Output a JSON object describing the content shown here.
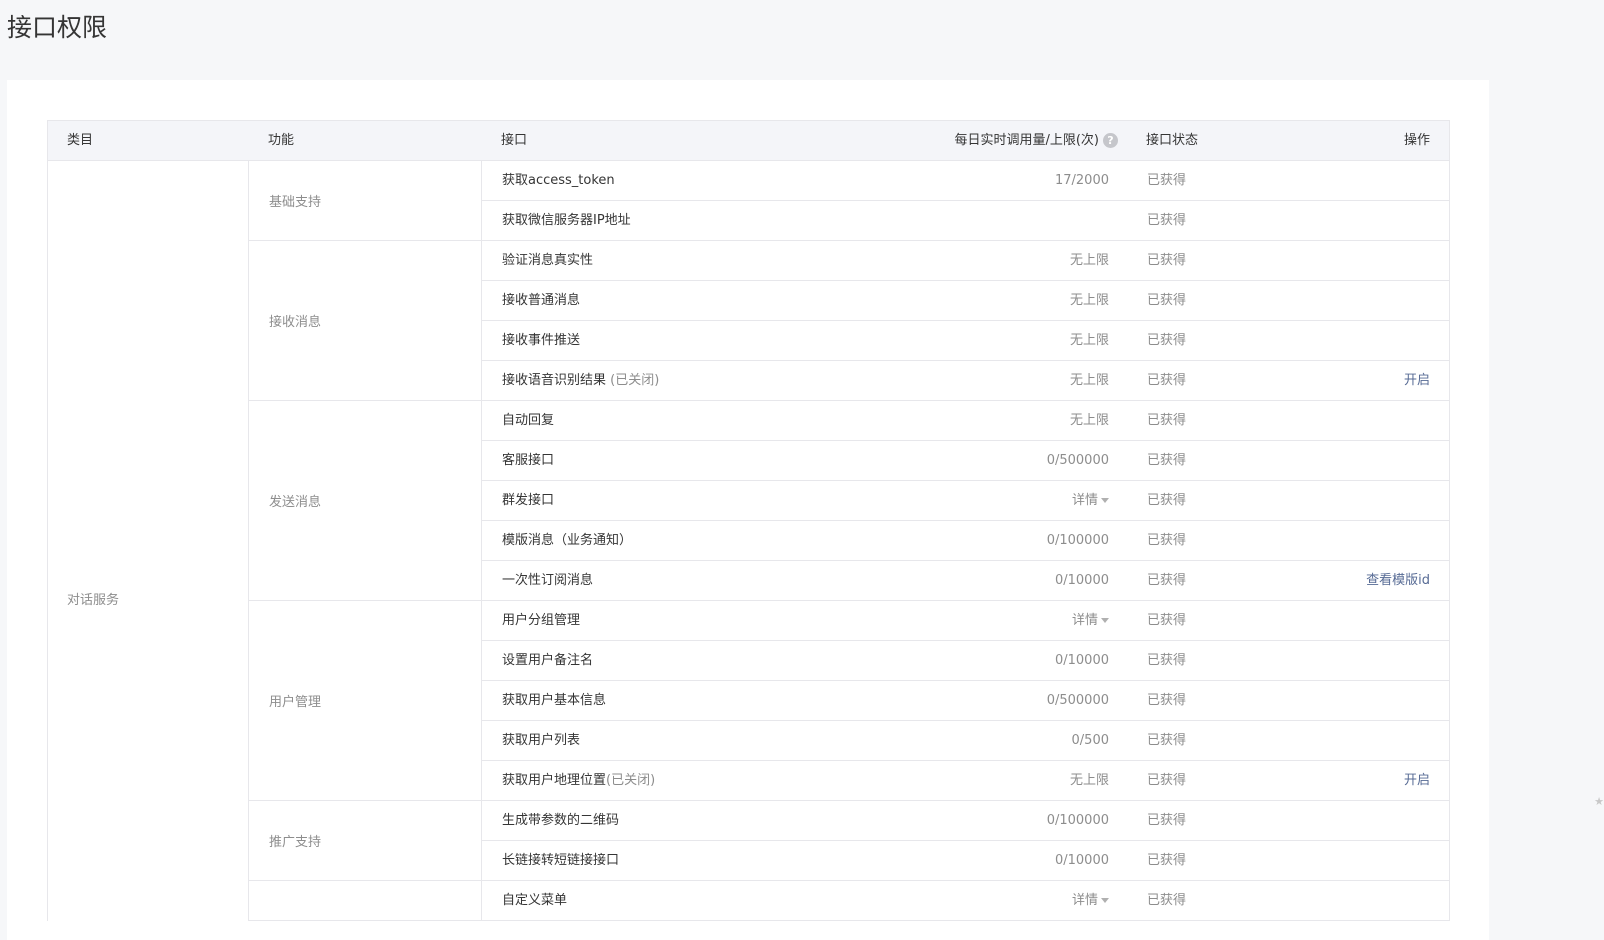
{
  "page_title": "接口权限",
  "header": {
    "category": "类目",
    "function": "功能",
    "api": "接口",
    "usage": "每日实时调用量/上限(次)",
    "status": "接口状态",
    "operation": "操作"
  },
  "category": "对话服务",
  "groups": [
    {
      "name": "基础支持",
      "rows": [
        {
          "api": "获取access_token",
          "closed": "",
          "usage": "17/2000",
          "status": "已获得",
          "op": ""
        },
        {
          "api": "获取微信服务器IP地址",
          "closed": "",
          "usage": "",
          "status": "已获得",
          "op": ""
        }
      ]
    },
    {
      "name": "接收消息",
      "rows": [
        {
          "api": "验证消息真实性",
          "closed": "",
          "usage": "无上限",
          "status": "已获得",
          "op": ""
        },
        {
          "api": "接收普通消息",
          "closed": "",
          "usage": "无上限",
          "status": "已获得",
          "op": ""
        },
        {
          "api": "接收事件推送",
          "closed": "",
          "usage": "无上限",
          "status": "已获得",
          "op": ""
        },
        {
          "api": "接收语音识别结果",
          "closed": " (已关闭)",
          "usage": "无上限",
          "status": "已获得",
          "op": "开启"
        }
      ]
    },
    {
      "name": "发送消息",
      "rows": [
        {
          "api": "自动回复",
          "closed": "",
          "usage": "无上限",
          "status": "已获得",
          "op": ""
        },
        {
          "api": "客服接口",
          "closed": "",
          "usage": "0/500000",
          "status": "已获得",
          "op": ""
        },
        {
          "api": "群发接口",
          "closed": "",
          "usage": "详情",
          "detail": true,
          "status": "已获得",
          "op": ""
        },
        {
          "api": "模版消息（业务通知）",
          "closed": "",
          "usage": "0/100000",
          "status": "已获得",
          "op": ""
        },
        {
          "api": "一次性订阅消息",
          "closed": "",
          "usage": "0/10000",
          "status": "已获得",
          "op": "查看模版id"
        }
      ]
    },
    {
      "name": "用户管理",
      "rows": [
        {
          "api": "用户分组管理",
          "closed": "",
          "usage": "详情",
          "detail": true,
          "status": "已获得",
          "op": ""
        },
        {
          "api": "设置用户备注名",
          "closed": "",
          "usage": "0/10000",
          "status": "已获得",
          "op": ""
        },
        {
          "api": "获取用户基本信息",
          "closed": "",
          "usage": "0/500000",
          "status": "已获得",
          "op": ""
        },
        {
          "api": "获取用户列表",
          "closed": "",
          "usage": "0/500",
          "status": "已获得",
          "op": ""
        },
        {
          "api": "获取用户地理位置",
          "closed": "(已关闭)",
          "usage": "无上限",
          "status": "已获得",
          "op": "开启"
        }
      ]
    },
    {
      "name": "推广支持",
      "rows": [
        {
          "api": "生成带参数的二维码",
          "closed": "",
          "usage": "0/100000",
          "status": "已获得",
          "op": ""
        },
        {
          "api": "长链接转短链接接口",
          "closed": "",
          "usage": "0/10000",
          "status": "已获得",
          "op": ""
        }
      ]
    },
    {
      "name": "",
      "rows": [
        {
          "api": "自定义菜单",
          "closed": "",
          "usage": "详情",
          "detail": true,
          "status": "已获得",
          "op": ""
        }
      ]
    }
  ],
  "icons": {
    "help": "question-circle-icon",
    "caret": "caret-down-icon"
  }
}
